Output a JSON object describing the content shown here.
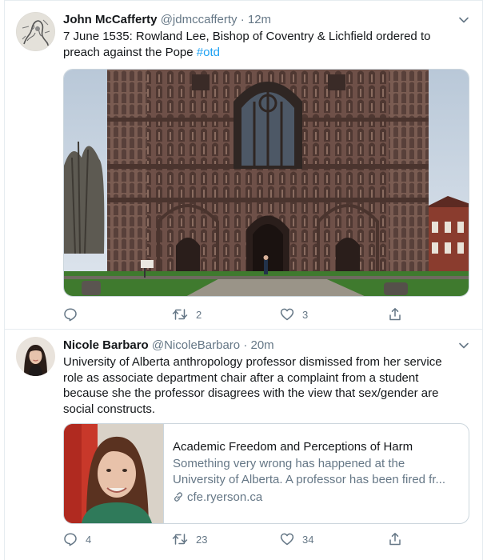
{
  "tweets": [
    {
      "author": {
        "display_name": "John McCafferty",
        "handle": "@jdmccafferty",
        "avatar_icon": "engraving-avatar"
      },
      "separator": "·",
      "time": "12m",
      "text": "7 June 1535: Rowland Lee, Bishop of Coventry & Lichfield ordered to preach against the Pope",
      "hashtag": "#otd",
      "media": {
        "kind": "photo",
        "subject": "cathedral-facade-photo"
      },
      "actions": {
        "reply": "",
        "retweet": "2",
        "like": "3",
        "share": ""
      }
    },
    {
      "author": {
        "display_name": "Nicole Barbaro",
        "handle": "@NicoleBarbaro",
        "avatar_icon": "portrait-avatar"
      },
      "separator": "·",
      "time": "20m",
      "text": "University of Alberta anthropology professor dismissed from her service role as associate department chair after a complaint from a student because she the professor disagrees with the view that sex/gender are social constructs.",
      "card": {
        "title": "Academic Freedom and Perceptions of Harm",
        "description": "Something very wrong has happened at the University of Alberta. A professor has been fired fr...",
        "domain": "cfe.ryerson.ca",
        "thumb_icon": "woman-portrait-thumbnail"
      },
      "actions": {
        "reply": "4",
        "retweet": "23",
        "like": "34",
        "share": ""
      }
    }
  ],
  "colors": {
    "text": "#14171a",
    "secondary": "#657786",
    "link": "#1da1f2",
    "border": "#e6ecf0"
  }
}
